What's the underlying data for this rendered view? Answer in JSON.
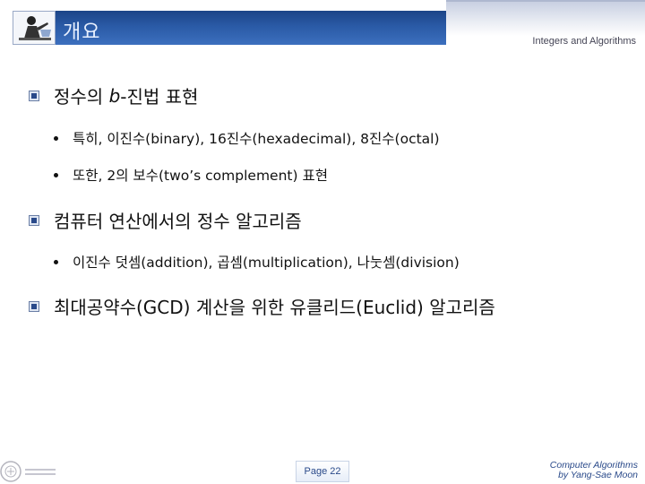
{
  "header": {
    "title": "개요",
    "subtitle": "Integers and Algorithms"
  },
  "content": {
    "sections": [
      {
        "heading_prefix": "정수의 ",
        "heading_italic": "b",
        "heading_suffix": "-진법 표현",
        "items": [
          "특히, 이진수(binary), 16진수(hexadecimal), 8진수(octal)",
          "또한, 2의 보수(two’s complement) 표현"
        ]
      },
      {
        "heading": "컴퓨터 연산에서의 정수 알고리즘",
        "items": [
          "이진수 덧셈(addition), 곱셈(multiplication), 나눗셈(division)"
        ]
      },
      {
        "heading": "최대공약수(GCD) 계산을 위한 유클리드(Euclid) 알고리즘",
        "items": []
      }
    ]
  },
  "footer": {
    "page": "Page 22",
    "credit_line1": "Computer Algorithms",
    "credit_line2": "by Yang-Sae Moon"
  },
  "colors": {
    "title_bar": "#2a5aa6",
    "title_text": "#e8f0ff",
    "accent_text": "#2a4a8a"
  },
  "icons": {
    "header": "teacher-at-desk-icon",
    "bullet": "square-bullet-icon",
    "footer_logo": "university-seal-icon"
  }
}
